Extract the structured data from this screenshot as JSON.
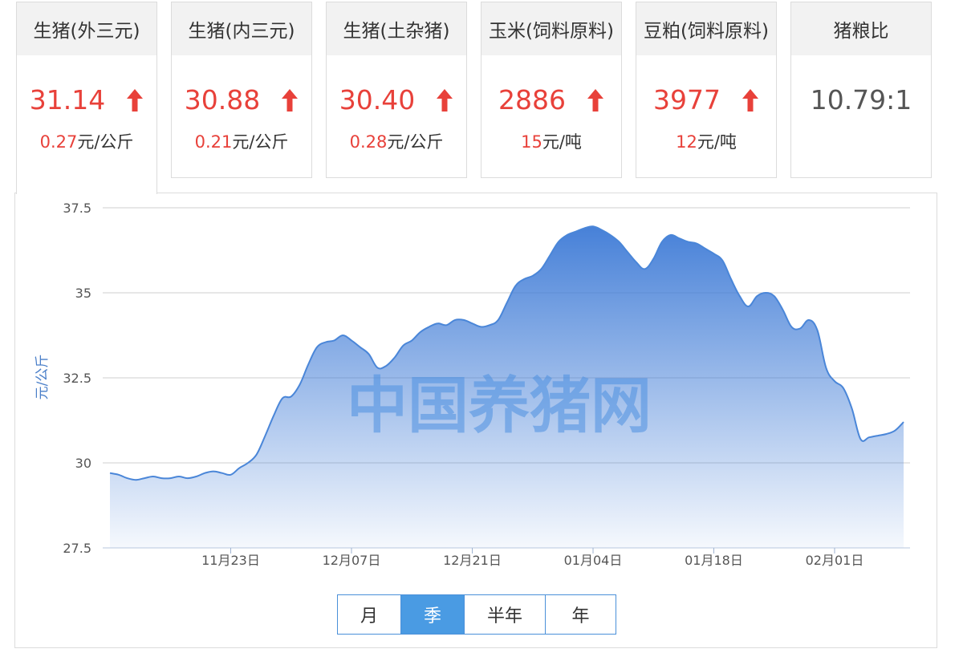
{
  "cards": [
    {
      "title": "生猪(外三元)",
      "value": "31.14",
      "change_num": "0.27",
      "change_unit": "元/公斤",
      "trend": "up",
      "active": true
    },
    {
      "title": "生猪(内三元)",
      "value": "30.88",
      "change_num": "0.21",
      "change_unit": "元/公斤",
      "trend": "up",
      "active": false
    },
    {
      "title": "生猪(土杂猪)",
      "value": "30.40",
      "change_num": "0.28",
      "change_unit": "元/公斤",
      "trend": "up",
      "active": false
    },
    {
      "title": "玉米(饲料原料)",
      "value": "2886",
      "change_num": "15",
      "change_unit": "元/吨",
      "trend": "up",
      "active": false
    },
    {
      "title": "豆粕(饲料原料)",
      "value": "3977",
      "change_num": "12",
      "change_unit": "元/吨",
      "trend": "up",
      "active": false
    },
    {
      "title": "猪粮比",
      "value": "10.79:1",
      "change_num": "",
      "change_unit": "",
      "trend": "none",
      "active": false
    }
  ],
  "colors": {
    "up": "#e8413a",
    "line": "#4a86d8",
    "fill_top": "#3d7ad6",
    "accent": "#4a9be3"
  },
  "watermark": "中国养猪网",
  "period_buttons": [
    {
      "label": "月",
      "active": false
    },
    {
      "label": "季",
      "active": true
    },
    {
      "label": "半年",
      "active": false
    },
    {
      "label": "年",
      "active": false
    }
  ],
  "chart_data": {
    "type": "area",
    "ylabel": "元/公斤",
    "y_ticks": [
      "37.5",
      "35",
      "32.5",
      "30",
      "27.5"
    ],
    "ylim": [
      27.5,
      37.5
    ],
    "x_tick_labels": [
      "11月23日",
      "12月07日",
      "12月21日",
      "01月04日",
      "01月18日",
      "02月01日"
    ],
    "x_tick_index": [
      14,
      28,
      42,
      56,
      70,
      84
    ],
    "grid": true,
    "values": [
      29.7,
      29.65,
      29.55,
      29.5,
      29.55,
      29.6,
      29.55,
      29.55,
      29.6,
      29.55,
      29.6,
      29.7,
      29.75,
      29.7,
      29.65,
      29.85,
      30.0,
      30.25,
      30.8,
      31.4,
      31.9,
      31.95,
      32.3,
      32.9,
      33.4,
      33.55,
      33.6,
      33.75,
      33.6,
      33.4,
      33.2,
      32.8,
      32.85,
      33.1,
      33.45,
      33.6,
      33.85,
      34.0,
      34.1,
      34.05,
      34.2,
      34.2,
      34.1,
      34.0,
      34.05,
      34.2,
      34.7,
      35.2,
      35.4,
      35.5,
      35.7,
      36.1,
      36.5,
      36.7,
      36.8,
      36.9,
      36.95,
      36.85,
      36.7,
      36.5,
      36.2,
      35.9,
      35.7,
      36.0,
      36.5,
      36.7,
      36.6,
      36.5,
      36.45,
      36.3,
      36.15,
      35.95,
      35.4,
      34.9,
      34.6,
      34.9,
      35.0,
      34.9,
      34.5,
      34.0,
      33.95,
      34.2,
      33.9,
      32.8,
      32.4,
      32.2,
      31.6,
      30.7,
      30.75,
      30.8,
      30.85,
      30.95,
      31.2
    ]
  }
}
